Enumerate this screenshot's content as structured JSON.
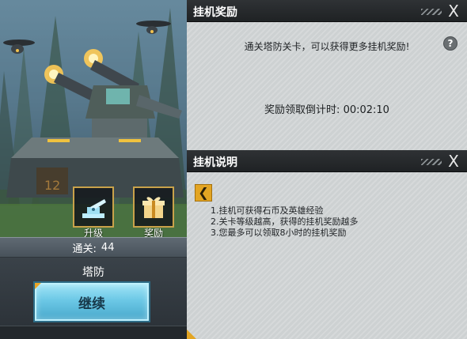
{
  "game": {
    "stage_label": "通关:",
    "stage_number": "44",
    "upgrade_label": "升级",
    "reward_label": "奖励",
    "mode_label": "塔防",
    "continue_label": "继续",
    "turret_plate_number": "12"
  },
  "idle_reward_panel": {
    "title": "挂机奖励",
    "close_symbol": "X",
    "info_text": "通关塔防关卡，可以获得更多挂机奖励!",
    "help_symbol": "?",
    "countdown_label": "奖励领取倒计时:",
    "countdown_value": "00:02:10"
  },
  "idle_description_panel": {
    "title": "挂机说明",
    "close_symbol": "X",
    "back_symbol": "❮",
    "lines": [
      "1.挂机可获得石币及英雄经验",
      "2.关卡等级越高，获得的挂机奖励越多",
      "3.您最多可以领取8小时的挂机奖励"
    ]
  },
  "colors": {
    "accent_gold": "#e3a523",
    "continue_button": "#6cc8e6",
    "panel_background": "#d1d5d6",
    "header_background": "#2f3235"
  }
}
